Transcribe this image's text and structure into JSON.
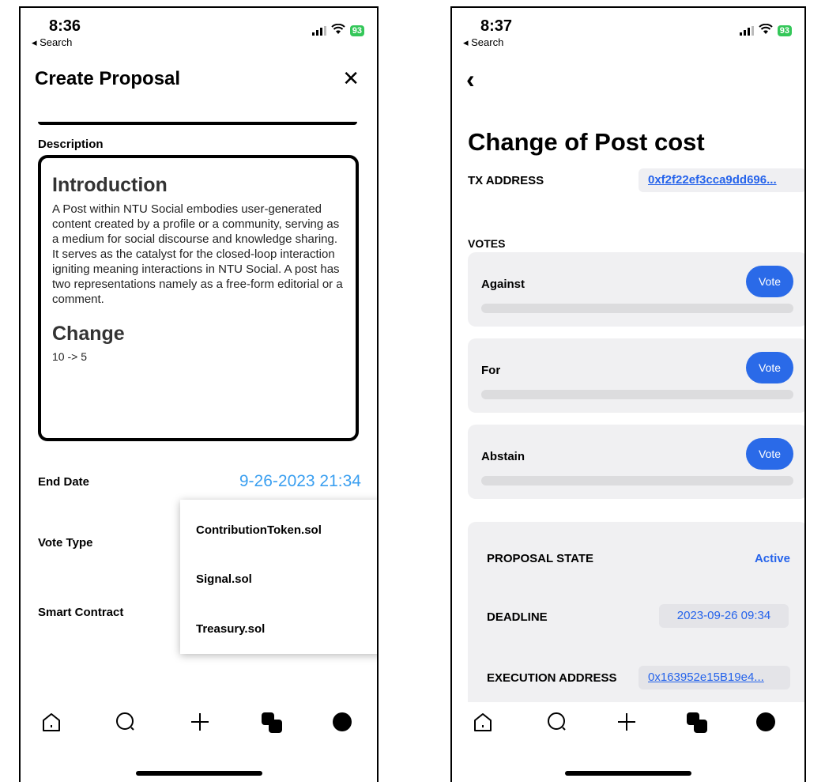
{
  "left": {
    "status": {
      "time": "8:36",
      "back_label": "◂ Search",
      "battery": "93"
    },
    "title": "Create Proposal",
    "close_glyph": "✕",
    "description_label": "Description",
    "description": {
      "intro_heading": "Introduction",
      "intro_text": "A Post within NTU Social embodies user-generated content created by a profile or a community, serving as a medium for social discourse and knowledge sharing. It serves as the catalyst for the closed-loop interaction igniting meaning interactions in NTU Social. A post has two representations namely as a free-form editorial  or a comment.",
      "change_heading": "Change",
      "change_text": "10 -> 5"
    },
    "end_date_label": "End Date",
    "end_date_value": "9-26-2023 21:34",
    "vote_type_label": "Vote Type",
    "smart_contract_label": "Smart Contract",
    "dropdown_options": [
      "ContributionToken.sol",
      "Signal.sol",
      "Treasury.sol"
    ]
  },
  "right": {
    "status": {
      "time": "8:37",
      "back_label": "◂ Search",
      "battery": "93"
    },
    "back_glyph": "‹",
    "title": "Change of Post cost",
    "tx_label": "TX ADDRESS",
    "tx_value": "0xf2f22ef3cca9dd696...",
    "votes_label": "VOTES",
    "vote_options": [
      {
        "name": "Against",
        "button": "Vote"
      },
      {
        "name": "For",
        "button": "Vote"
      },
      {
        "name": "Abstain",
        "button": "Vote"
      }
    ],
    "proposal_state_label": "PROPOSAL STATE",
    "proposal_state_value": "Active",
    "deadline_label": "DEADLINE",
    "deadline_value": "2023-09-26 09:34",
    "execution_label": "EXECUTION ADDRESS",
    "execution_value": "0x163952e15B19e4..."
  },
  "icons": [
    "home-icon",
    "search-icon",
    "plus-icon",
    "communities-icon",
    "profile-icon"
  ],
  "colors": {
    "link_blue": "#2563eb",
    "date_blue": "#3a9ff0",
    "vote_button": "#2a6ae8",
    "card_bg": "#f0f0f2"
  }
}
